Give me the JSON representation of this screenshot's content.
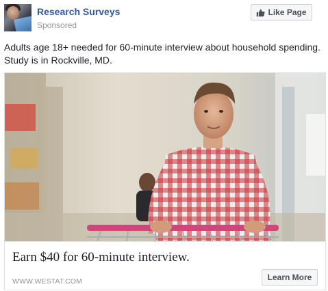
{
  "page": {
    "name": "Research Surveys",
    "sponsored_label": "Sponsored",
    "like_button_label": "Like Page",
    "like_icon": "thumbs-up-icon"
  },
  "post": {
    "text": "Adults age 18+ needed for 60-minute interview about household spending. Study is in Rockville, MD."
  },
  "ad_card": {
    "image_icon": "man-with-shopping-cart-photo",
    "headline": "Earn $40 for 60-minute interview.",
    "domain": "WWW.WESTAT.COM",
    "cta_label": "Learn More"
  },
  "colors": {
    "link_blue": "#365899",
    "muted_gray": "#90949c",
    "button_bg": "#f6f7f9",
    "border": "#dddfe2"
  }
}
